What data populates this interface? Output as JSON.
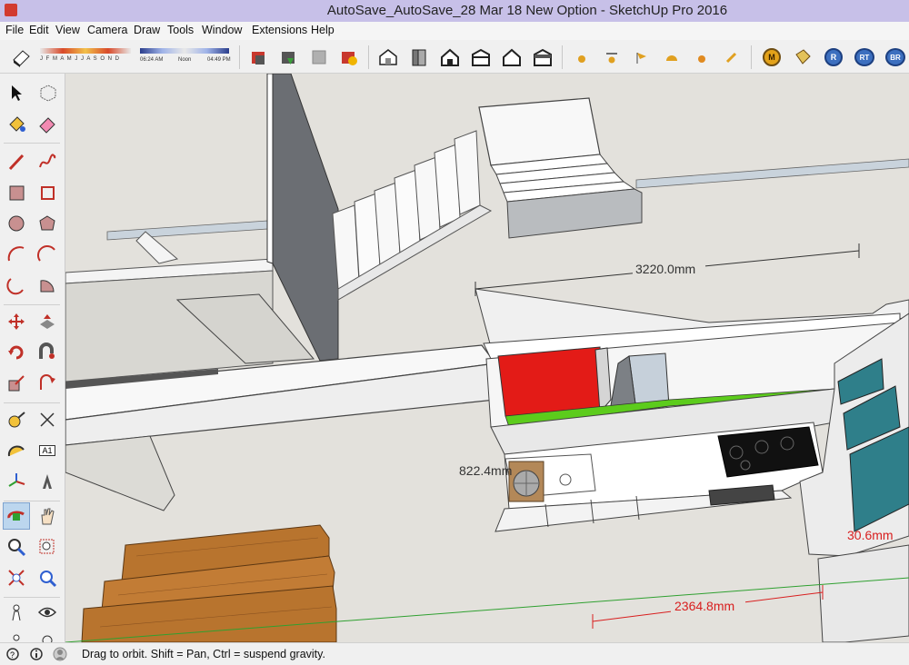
{
  "window": {
    "title": "AutoSave_AutoSave_28 Mar 18 New Option - SketchUp Pro 2016"
  },
  "menu": [
    "File",
    "Edit",
    "View",
    "Camera",
    "Draw",
    "Tools",
    "Window",
    "Extensions",
    "Help"
  ],
  "shadow_settings": {
    "months": "J F M A M J J A S O N D",
    "time_start": "06:24 AM",
    "time_noon": "Noon",
    "time_end": "04:49 PM"
  },
  "toolbar_text_buttons": {
    "m": "M",
    "r": "R",
    "rt": "RT",
    "br": "BR"
  },
  "viewport": {
    "dimensions": [
      "3220.0mm",
      "822.4mm",
      "2364.8mm",
      "30.6mm"
    ],
    "colors": {
      "background": "#e3e1dc",
      "red_block": "#e31b17",
      "green_strip": "#5ccc1c",
      "wood": "#b8742e",
      "teal_glass": "#2f7f8a"
    }
  },
  "left_tools": {
    "text_tool_label": "A1"
  },
  "status": {
    "text": "Drag to orbit. Shift = Pan, Ctrl = suspend gravity."
  }
}
